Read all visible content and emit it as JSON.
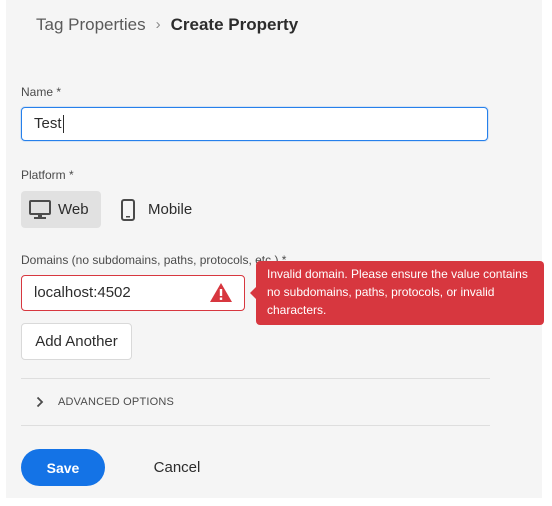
{
  "breadcrumb": {
    "parent": "Tag Properties",
    "separator": "›",
    "current": "Create Property"
  },
  "name_field": {
    "label": "Name *",
    "value": "Test"
  },
  "platform": {
    "label": "Platform *",
    "options": [
      {
        "label": "Web",
        "icon": "desktop-icon",
        "selected": true
      },
      {
        "label": "Mobile",
        "icon": "mobile-icon",
        "selected": false
      }
    ]
  },
  "domains": {
    "label": "Domains (no subdomains, paths, protocols, etc.) *",
    "value": "localhost:4502",
    "error_icon": "alert-triangle-icon",
    "error_message": "Invalid domain. Please ensure the value contains no subdomains, paths, protocols, or invalid characters.",
    "add_another_label": "Add Another"
  },
  "advanced": {
    "label": "ADVANCED OPTIONS",
    "icon": "chevron-right-icon"
  },
  "actions": {
    "save_label": "Save",
    "cancel_label": "Cancel"
  },
  "colors": {
    "accent": "#1473e6",
    "error": "#d7373f",
    "focus_border": "#2680eb",
    "background": "#f5f5f5"
  }
}
